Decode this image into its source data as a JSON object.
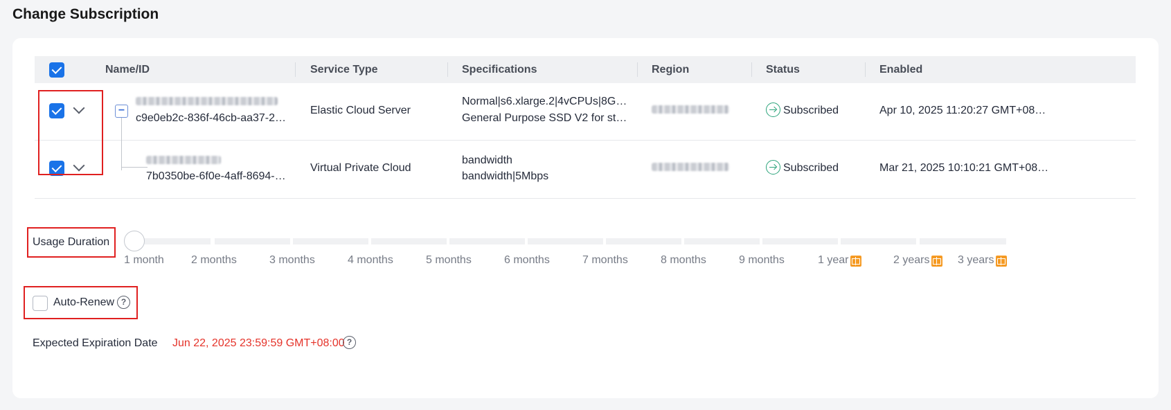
{
  "page": {
    "title": "Change Subscription"
  },
  "table": {
    "columns": [
      "Name/ID",
      "Service Type",
      "Specifications",
      "Region",
      "Status",
      "Enabled"
    ],
    "rows": [
      {
        "id": "c9e0eb2c-836f-46cb-aa37-2…",
        "service_type": "Elastic Cloud Server",
        "spec_line1": "Normal|s6.xlarge.2|4vCPUs|8G…",
        "spec_line2": "General Purpose SSD V2 for st…",
        "status": "Subscribed",
        "enabled": "Apr 10, 2025 11:20:27 GMT+08…"
      },
      {
        "id": "7b0350be-6f0e-4aff-8694-…",
        "service_type": "Virtual Private Cloud",
        "spec_line1": "bandwidth",
        "spec_line2": "bandwidth|5Mbps",
        "status": "Subscribed",
        "enabled": "Mar 21, 2025 10:10:21 GMT+08…"
      }
    ]
  },
  "usage_duration": {
    "label": "Usage Duration",
    "selected": "1 month",
    "options": [
      "1 month",
      "2 months",
      "3 months",
      "4 months",
      "5 months",
      "6 months",
      "7 months",
      "8 months",
      "9 months",
      "1 year",
      "2 years",
      "3 years"
    ]
  },
  "auto_renew": {
    "label": "Auto-Renew",
    "checked": false
  },
  "expiration": {
    "label": "Expected Expiration Date",
    "value": "Jun 22, 2025 23:59:59 GMT+08:00",
    "value_color": "#e5332a"
  },
  "colors": {
    "accent": "#1a73e8",
    "status_ok": "#2aa37a",
    "highlight_box": "#e02020",
    "gift": "#f59a23"
  }
}
